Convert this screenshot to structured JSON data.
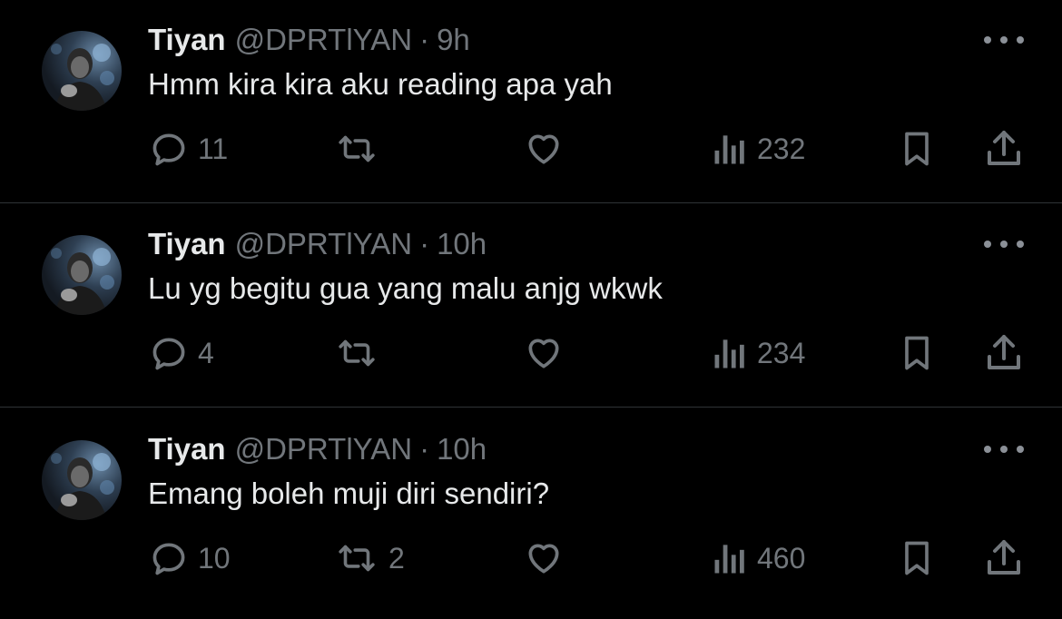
{
  "tweets": [
    {
      "name": "Tiyan",
      "handle": "@DPRTlYAN",
      "separator": "·",
      "time": "9h",
      "text": "Hmm kira kira aku reading apa yah",
      "replies": "11",
      "retweets": "",
      "likes": "",
      "views": "232"
    },
    {
      "name": "Tiyan",
      "handle": "@DPRTlYAN",
      "separator": "·",
      "time": "10h",
      "text": "Lu yg begitu gua yang malu anjg wkwk",
      "replies": "4",
      "retweets": "",
      "likes": "",
      "views": "234"
    },
    {
      "name": "Tiyan",
      "handle": "@DPRTlYAN",
      "separator": "·",
      "time": "10h",
      "text": "Emang boleh muji diri sendiri?",
      "replies": "10",
      "retweets": "2",
      "likes": "",
      "views": "460"
    }
  ],
  "icons": {
    "reply": "reply-icon",
    "retweet": "retweet-icon",
    "like": "heart-icon",
    "views": "views-icon",
    "bookmark": "bookmark-icon",
    "share": "share-icon",
    "more": "more-icon"
  },
  "colors": {
    "background": "#000000",
    "primary_text": "#e7e9ea",
    "secondary_text": "#71767b",
    "divider": "#2f3336"
  }
}
